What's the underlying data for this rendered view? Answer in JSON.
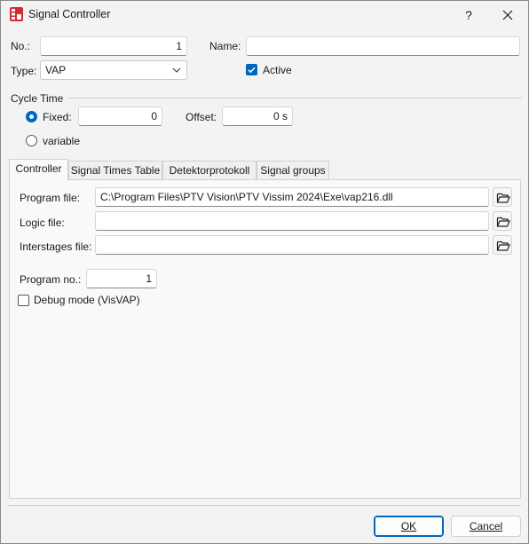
{
  "window": {
    "title": "Signal Controller",
    "help_label": "?"
  },
  "general": {
    "no_label": "No.:",
    "no_value": "1",
    "name_label": "Name:",
    "name_value": "",
    "type_label": "Type:",
    "type_value": "VAP",
    "active_label": "Active",
    "active_checked": true
  },
  "cycle_time": {
    "section_label": "Cycle Time",
    "fixed_label": "Fixed:",
    "fixed_value": "0",
    "offset_label": "Offset:",
    "offset_value": "0 s",
    "variable_label": "variable",
    "mode": "fixed"
  },
  "tabs": [
    {
      "label": "Controller",
      "active": true
    },
    {
      "label": "Signal Times Table",
      "active": false
    },
    {
      "label": "Detektorprotokoll",
      "active": false
    },
    {
      "label": "Signal groups",
      "active": false
    }
  ],
  "controller": {
    "program_file_label": "Program file:",
    "program_file_value": "C:\\Program Files\\PTV Vision\\PTV Vissim 2024\\Exe\\vap216.dll",
    "logic_file_label": "Logic file:",
    "logic_file_value": "",
    "interstages_file_label": "Interstages file:",
    "interstages_file_value": "",
    "program_no_label": "Program no.:",
    "program_no_value": "1",
    "debug_label": "Debug mode (VisVAP)",
    "debug_checked": false
  },
  "footer": {
    "ok_label": "OK",
    "cancel_label": "Cancel"
  },
  "colors": {
    "accent": "#0067c0",
    "icon_red": "#d42c2c"
  }
}
